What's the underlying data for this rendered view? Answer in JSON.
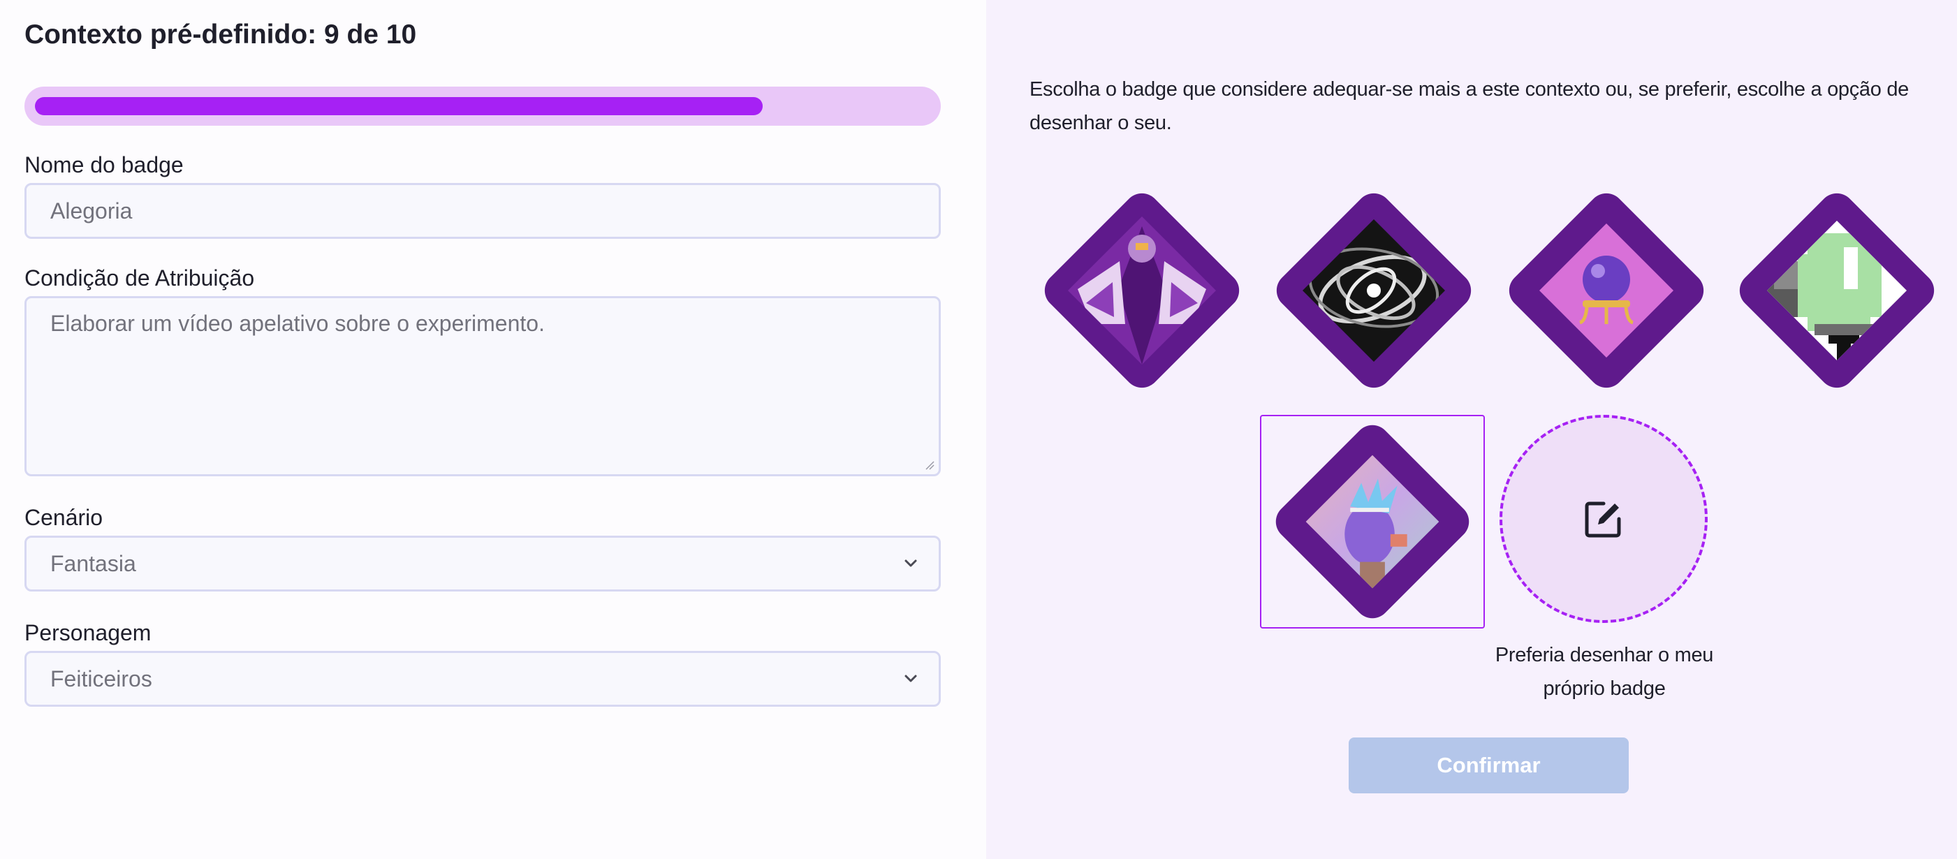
{
  "header": {
    "title": "Contexto pré-definido: 9 de 10",
    "progress_fraction": 0.9
  },
  "form": {
    "badge_name": {
      "label": "Nome do badge",
      "placeholder": "Alegoria"
    },
    "condition": {
      "label": "Condição de Atribuição",
      "placeholder": "Elaborar um vídeo apelativo sobre o experimento."
    },
    "scenario": {
      "label": "Cenário",
      "value": "Fantasia"
    },
    "character": {
      "label": "Personagem",
      "value": "Feiticeiros"
    }
  },
  "badges": {
    "instructions": "Escolha o badge que considere adequar-se mais a este contexto ou, se preferir, escolhe a opção de desenhar o seu.",
    "items": [
      {
        "icon": "hooded-sorcerer-badge-icon",
        "selected": false
      },
      {
        "icon": "swirl-vortex-badge-icon",
        "selected": false
      },
      {
        "icon": "crystal-ball-badge-icon",
        "selected": false
      },
      {
        "icon": "pixel-tree-badge-icon",
        "selected": false
      },
      {
        "icon": "spiky-hair-character-badge-icon",
        "selected": true
      }
    ],
    "draw_option": {
      "icon": "edit-pencil-icon",
      "caption": "Preferia desenhar o meu próprio badge"
    }
  },
  "actions": {
    "confirm_label": "Confirmar",
    "confirm_enabled": false
  },
  "colors": {
    "accent": "#a621f4",
    "progress_track": "#e9c7f8",
    "badge_frame": "#5f1a8c",
    "right_panel_bg": "#f7f1fd",
    "confirm_disabled": "#b4c6ea"
  }
}
